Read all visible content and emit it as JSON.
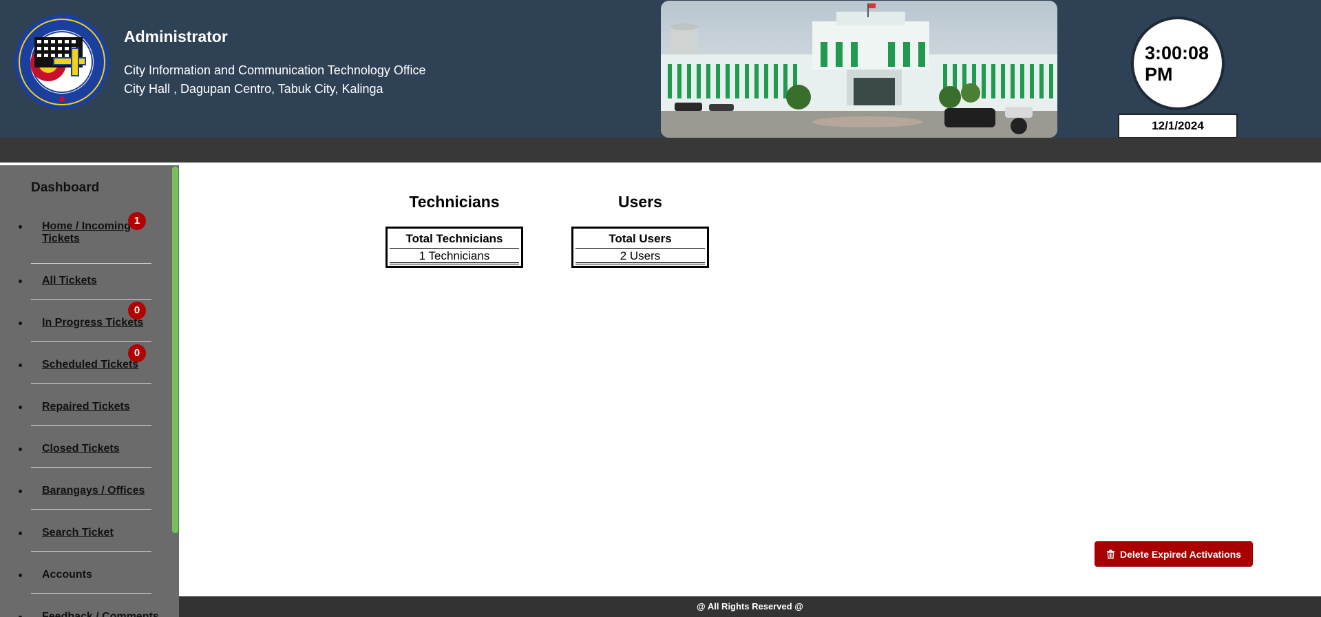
{
  "header": {
    "role_title": "Administrator",
    "office_name": "City Information and Communication Technology Office",
    "office_address": "City Hall , Dagupan Centro, Tabuk City, Kalinga",
    "logo_icon": "seal-icon",
    "photo_icon": "city-hall-photo"
  },
  "clock": {
    "time": "3:00:08",
    "ampm": "PM",
    "date": "12/1/2024"
  },
  "sidebar": {
    "title": "Dashboard",
    "items": [
      {
        "label": "Home / Incoming Tickets",
        "badge": "1"
      },
      {
        "label": "All Tickets"
      },
      {
        "label": "In Progress Tickets",
        "badge": "0"
      },
      {
        "label": "Scheduled Tickets",
        "badge": "0"
      },
      {
        "label": "Repaired Tickets"
      },
      {
        "label": "Closed Tickets"
      },
      {
        "label": "Barangays / Offices"
      },
      {
        "label": "Search Ticket"
      },
      {
        "label": "Accounts"
      },
      {
        "label": "Feedback / Comments"
      }
    ],
    "scrollbar_color": "#78c25d"
  },
  "stats": {
    "technicians": {
      "heading": "Technicians",
      "header": "Total Technicians",
      "value": "1 Technicians"
    },
    "users": {
      "heading": "Users",
      "header": "Total Users",
      "value": "2 Users"
    }
  },
  "actions": {
    "delete_label": "Delete Expired Activations",
    "delete_icon": "trash-icon",
    "accent_color": "#a80000"
  },
  "footer": {
    "text": "@ All Rights Reserved @"
  },
  "colors": {
    "header_bg": "#2f4155",
    "nav_bg": "#383838",
    "sidebar_bg": "#6b6b6b",
    "badge": "#b30000"
  }
}
